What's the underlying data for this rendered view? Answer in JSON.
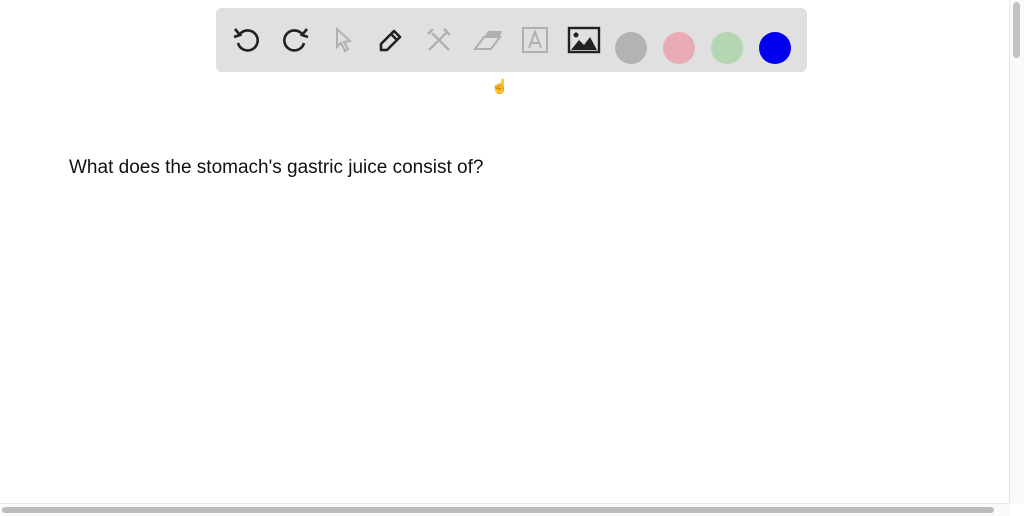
{
  "toolbar": {
    "tools": [
      {
        "name": "undo-icon",
        "enabled": true
      },
      {
        "name": "redo-icon",
        "enabled": true
      },
      {
        "name": "pointer-icon",
        "enabled": false
      },
      {
        "name": "pen-icon",
        "enabled": true
      },
      {
        "name": "tools-icon",
        "enabled": false
      },
      {
        "name": "eraser-icon",
        "enabled": false
      },
      {
        "name": "text-icon",
        "enabled": false
      },
      {
        "name": "image-icon",
        "enabled": true
      }
    ],
    "colors": [
      "#b3b3b3",
      "#e8aab4",
      "#b5d6b3",
      "#0000ee"
    ]
  },
  "content": {
    "question": "What does the stomach's gastric juice consist of?"
  }
}
